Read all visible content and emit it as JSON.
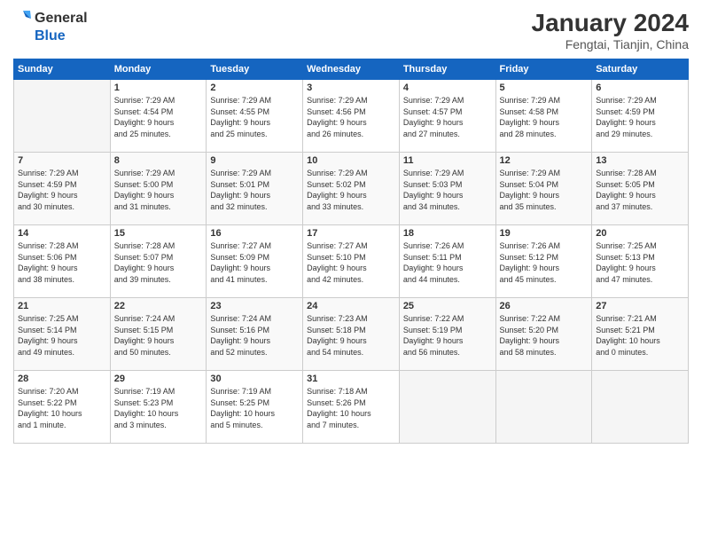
{
  "logo": {
    "text_general": "General",
    "text_blue": "Blue"
  },
  "title": "January 2024",
  "subtitle": "Fengtai, Tianjin, China",
  "days_of_week": [
    "Sunday",
    "Monday",
    "Tuesday",
    "Wednesday",
    "Thursday",
    "Friday",
    "Saturday"
  ],
  "weeks": [
    [
      {
        "day": "",
        "info": ""
      },
      {
        "day": "1",
        "info": "Sunrise: 7:29 AM\nSunset: 4:54 PM\nDaylight: 9 hours\nand 25 minutes."
      },
      {
        "day": "2",
        "info": "Sunrise: 7:29 AM\nSunset: 4:55 PM\nDaylight: 9 hours\nand 25 minutes."
      },
      {
        "day": "3",
        "info": "Sunrise: 7:29 AM\nSunset: 4:56 PM\nDaylight: 9 hours\nand 26 minutes."
      },
      {
        "day": "4",
        "info": "Sunrise: 7:29 AM\nSunset: 4:57 PM\nDaylight: 9 hours\nand 27 minutes."
      },
      {
        "day": "5",
        "info": "Sunrise: 7:29 AM\nSunset: 4:58 PM\nDaylight: 9 hours\nand 28 minutes."
      },
      {
        "day": "6",
        "info": "Sunrise: 7:29 AM\nSunset: 4:59 PM\nDaylight: 9 hours\nand 29 minutes."
      }
    ],
    [
      {
        "day": "7",
        "info": "Sunrise: 7:29 AM\nSunset: 4:59 PM\nDaylight: 9 hours\nand 30 minutes."
      },
      {
        "day": "8",
        "info": "Sunrise: 7:29 AM\nSunset: 5:00 PM\nDaylight: 9 hours\nand 31 minutes."
      },
      {
        "day": "9",
        "info": "Sunrise: 7:29 AM\nSunset: 5:01 PM\nDaylight: 9 hours\nand 32 minutes."
      },
      {
        "day": "10",
        "info": "Sunrise: 7:29 AM\nSunset: 5:02 PM\nDaylight: 9 hours\nand 33 minutes."
      },
      {
        "day": "11",
        "info": "Sunrise: 7:29 AM\nSunset: 5:03 PM\nDaylight: 9 hours\nand 34 minutes."
      },
      {
        "day": "12",
        "info": "Sunrise: 7:29 AM\nSunset: 5:04 PM\nDaylight: 9 hours\nand 35 minutes."
      },
      {
        "day": "13",
        "info": "Sunrise: 7:28 AM\nSunset: 5:05 PM\nDaylight: 9 hours\nand 37 minutes."
      }
    ],
    [
      {
        "day": "14",
        "info": "Sunrise: 7:28 AM\nSunset: 5:06 PM\nDaylight: 9 hours\nand 38 minutes."
      },
      {
        "day": "15",
        "info": "Sunrise: 7:28 AM\nSunset: 5:07 PM\nDaylight: 9 hours\nand 39 minutes."
      },
      {
        "day": "16",
        "info": "Sunrise: 7:27 AM\nSunset: 5:09 PM\nDaylight: 9 hours\nand 41 minutes."
      },
      {
        "day": "17",
        "info": "Sunrise: 7:27 AM\nSunset: 5:10 PM\nDaylight: 9 hours\nand 42 minutes."
      },
      {
        "day": "18",
        "info": "Sunrise: 7:26 AM\nSunset: 5:11 PM\nDaylight: 9 hours\nand 44 minutes."
      },
      {
        "day": "19",
        "info": "Sunrise: 7:26 AM\nSunset: 5:12 PM\nDaylight: 9 hours\nand 45 minutes."
      },
      {
        "day": "20",
        "info": "Sunrise: 7:25 AM\nSunset: 5:13 PM\nDaylight: 9 hours\nand 47 minutes."
      }
    ],
    [
      {
        "day": "21",
        "info": "Sunrise: 7:25 AM\nSunset: 5:14 PM\nDaylight: 9 hours\nand 49 minutes."
      },
      {
        "day": "22",
        "info": "Sunrise: 7:24 AM\nSunset: 5:15 PM\nDaylight: 9 hours\nand 50 minutes."
      },
      {
        "day": "23",
        "info": "Sunrise: 7:24 AM\nSunset: 5:16 PM\nDaylight: 9 hours\nand 52 minutes."
      },
      {
        "day": "24",
        "info": "Sunrise: 7:23 AM\nSunset: 5:18 PM\nDaylight: 9 hours\nand 54 minutes."
      },
      {
        "day": "25",
        "info": "Sunrise: 7:22 AM\nSunset: 5:19 PM\nDaylight: 9 hours\nand 56 minutes."
      },
      {
        "day": "26",
        "info": "Sunrise: 7:22 AM\nSunset: 5:20 PM\nDaylight: 9 hours\nand 58 minutes."
      },
      {
        "day": "27",
        "info": "Sunrise: 7:21 AM\nSunset: 5:21 PM\nDaylight: 10 hours\nand 0 minutes."
      }
    ],
    [
      {
        "day": "28",
        "info": "Sunrise: 7:20 AM\nSunset: 5:22 PM\nDaylight: 10 hours\nand 1 minute."
      },
      {
        "day": "29",
        "info": "Sunrise: 7:19 AM\nSunset: 5:23 PM\nDaylight: 10 hours\nand 3 minutes."
      },
      {
        "day": "30",
        "info": "Sunrise: 7:19 AM\nSunset: 5:25 PM\nDaylight: 10 hours\nand 5 minutes."
      },
      {
        "day": "31",
        "info": "Sunrise: 7:18 AM\nSunset: 5:26 PM\nDaylight: 10 hours\nand 7 minutes."
      },
      {
        "day": "",
        "info": ""
      },
      {
        "day": "",
        "info": ""
      },
      {
        "day": "",
        "info": ""
      }
    ]
  ]
}
